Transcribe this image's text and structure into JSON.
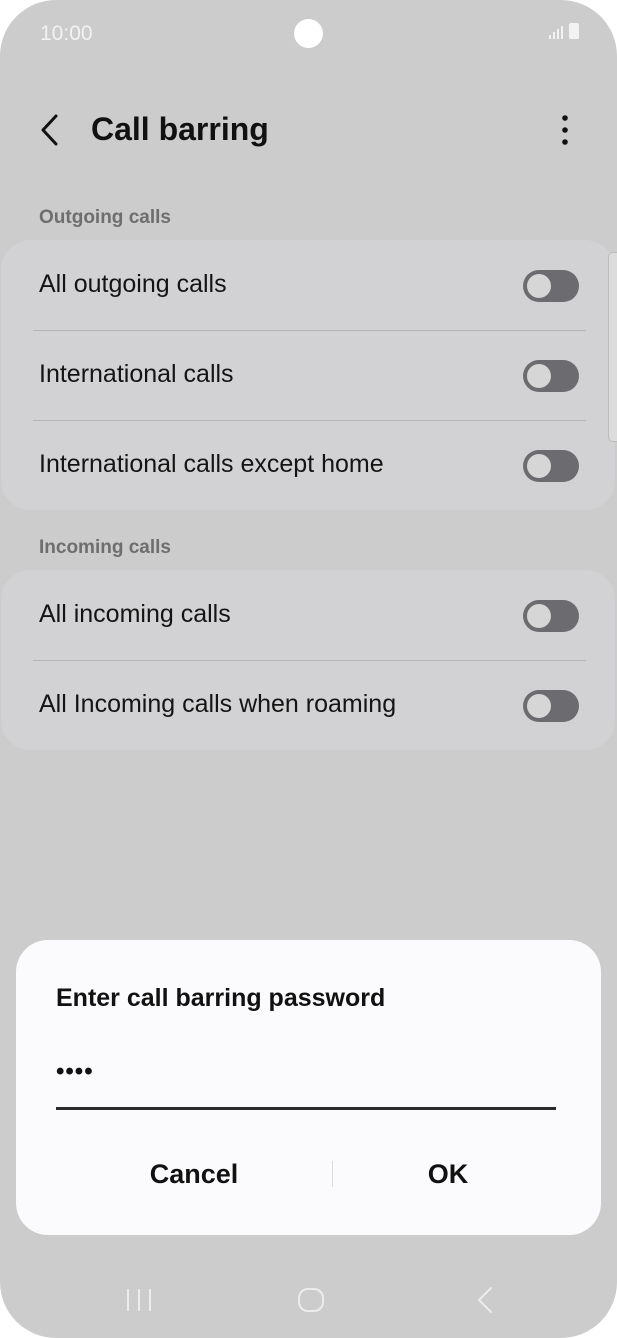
{
  "status_bar": {
    "time": "10:00",
    "signal_icon": "signal-icon",
    "battery_icon": "battery-icon"
  },
  "header": {
    "title": "Call barring",
    "back_icon": "back-arrow-icon",
    "more_icon": "more-options-icon"
  },
  "sections": [
    {
      "label": "Outgoing calls",
      "items": [
        {
          "label": "All outgoing calls",
          "enabled": false
        },
        {
          "label": "International calls",
          "enabled": false
        },
        {
          "label": "International calls except home",
          "enabled": false
        }
      ]
    },
    {
      "label": "Incoming calls",
      "items": [
        {
          "label": "All incoming calls",
          "enabled": false
        },
        {
          "label": "All Incoming calls when roaming",
          "enabled": false
        }
      ]
    }
  ],
  "dialog": {
    "title": "Enter call barring password",
    "password_value": "••••",
    "cancel_label": "Cancel",
    "ok_label": "OK"
  },
  "nav_bar": {
    "recents_icon": "recents-icon",
    "home_icon": "home-icon",
    "back_icon": "nav-back-icon"
  },
  "colors": {
    "background": "#cccccc",
    "card": "#d2d2d4",
    "toggle_off": "#6b6b70",
    "dialog": "#fbfbfd"
  }
}
